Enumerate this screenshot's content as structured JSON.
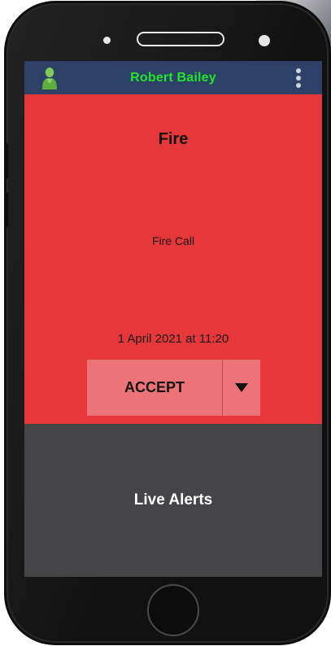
{
  "header": {
    "user_name": "Robert Bailey",
    "avatar_icon": "user-avatar-icon",
    "menu_icon": "more-vertical-icon"
  },
  "alert": {
    "title": "Fire",
    "description": "Fire Call",
    "timestamp": "1 April 2021 at 11:20",
    "accept_label": "ACCEPT",
    "dropdown_icon": "caret-down-icon"
  },
  "footer": {
    "live_alerts_label": "Live Alerts"
  },
  "colors": {
    "header_bg": "#2d4166",
    "user_name": "#22e52b",
    "alert_bg": "#e6383a",
    "accept_bg": "#ec7478",
    "live_alerts_bg": "#454447"
  }
}
